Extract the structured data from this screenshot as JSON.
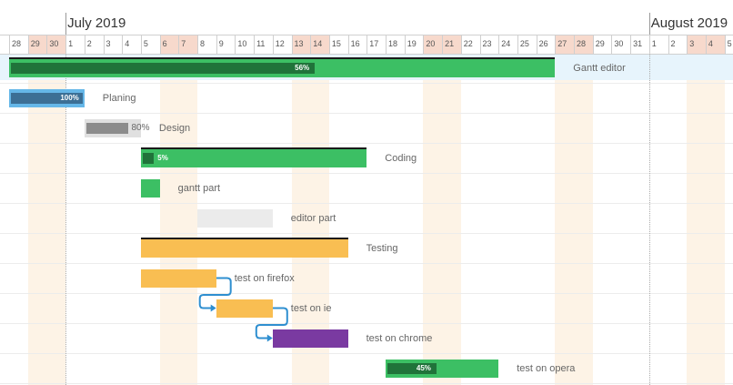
{
  "timeline": {
    "months": [
      {
        "label": "July 2019"
      },
      {
        "label": "August 2019"
      }
    ],
    "days": [
      {
        "label": "28",
        "weekend": false
      },
      {
        "label": "29",
        "weekend": true
      },
      {
        "label": "30",
        "weekend": true
      },
      {
        "label": "1",
        "weekend": false
      },
      {
        "label": "2",
        "weekend": false
      },
      {
        "label": "3",
        "weekend": false
      },
      {
        "label": "4",
        "weekend": false
      },
      {
        "label": "5",
        "weekend": false
      },
      {
        "label": "6",
        "weekend": true
      },
      {
        "label": "7",
        "weekend": true
      },
      {
        "label": "8",
        "weekend": false
      },
      {
        "label": "9",
        "weekend": false
      },
      {
        "label": "10",
        "weekend": false
      },
      {
        "label": "11",
        "weekend": false
      },
      {
        "label": "12",
        "weekend": false
      },
      {
        "label": "13",
        "weekend": true
      },
      {
        "label": "14",
        "weekend": true
      },
      {
        "label": "15",
        "weekend": false
      },
      {
        "label": "16",
        "weekend": false
      },
      {
        "label": "17",
        "weekend": false
      },
      {
        "label": "18",
        "weekend": false
      },
      {
        "label": "19",
        "weekend": false
      },
      {
        "label": "20",
        "weekend": true
      },
      {
        "label": "21",
        "weekend": true
      },
      {
        "label": "22",
        "weekend": false
      },
      {
        "label": "23",
        "weekend": false
      },
      {
        "label": "24",
        "weekend": false
      },
      {
        "label": "25",
        "weekend": false
      },
      {
        "label": "26",
        "weekend": false
      },
      {
        "label": "27",
        "weekend": true
      },
      {
        "label": "28",
        "weekend": true
      },
      {
        "label": "29",
        "weekend": false
      },
      {
        "label": "30",
        "weekend": false
      },
      {
        "label": "31",
        "weekend": false
      },
      {
        "label": "1",
        "weekend": false
      },
      {
        "label": "2",
        "weekend": false
      },
      {
        "label": "3",
        "weekend": true
      },
      {
        "label": "4",
        "weekend": true
      },
      {
        "label": "5",
        "weekend": false
      }
    ]
  },
  "tasks": [
    {
      "name": "Gantt editor",
      "start": 0,
      "duration": 29,
      "progress": 56,
      "progress_label": "56%",
      "color": "#3cbf64",
      "progress_color": "#20733a",
      "summary": true,
      "highlight": true
    },
    {
      "name": "Planing",
      "start": 0,
      "duration": 4,
      "progress": 100,
      "progress_label": "100%",
      "color": "#65b7e8",
      "progress_color": "#3c6f95",
      "summary": false
    },
    {
      "name": "Design",
      "start": 4,
      "duration": 3,
      "progress": 80,
      "progress_label": "80%",
      "color": "#e0e0e0",
      "progress_color": "#8c8c8c",
      "summary": false,
      "pct_outside": true
    },
    {
      "name": "Coding",
      "start": 7,
      "duration": 12,
      "progress": 5,
      "progress_label": "5%",
      "color": "#3cbf64",
      "progress_color": "#20733a",
      "summary": true
    },
    {
      "name": "gantt part",
      "start": 7,
      "duration": 1,
      "progress": 0,
      "progress_label": "",
      "color": "#3cbf64",
      "progress_color": "#20733a",
      "summary": false
    },
    {
      "name": "editor part",
      "start": 10,
      "duration": 4,
      "progress": 0,
      "progress_label": "",
      "color": "#ebebeb",
      "progress_color": "#8c8c8c",
      "summary": false
    },
    {
      "name": "Testing",
      "start": 7,
      "duration": 11,
      "progress": 0,
      "progress_label": "",
      "color": "#f9be52",
      "progress_color": "#f9be52",
      "summary": true
    },
    {
      "name": "test on firefox",
      "start": 7,
      "duration": 4,
      "progress": 0,
      "progress_label": "",
      "color": "#f9be52",
      "progress_color": "#f9be52",
      "summary": false
    },
    {
      "name": "test on ie",
      "start": 11,
      "duration": 3,
      "progress": 0,
      "progress_label": "",
      "color": "#f9be52",
      "progress_color": "#f9be52",
      "summary": false
    },
    {
      "name": "test on chrome",
      "start": 14,
      "duration": 4,
      "progress": 0,
      "progress_label": "",
      "color": "#7a3aa1",
      "progress_color": "#7a3aa1",
      "summary": false
    },
    {
      "name": "test on opera",
      "start": 20,
      "duration": 6,
      "progress": 45,
      "progress_label": "45%",
      "color": "#3cbf64",
      "progress_color": "#20733a",
      "summary": false
    }
  ],
  "links": [
    {
      "from": "test on firefox",
      "to": "test on ie"
    },
    {
      "from": "test on ie",
      "to": "test on chrome"
    }
  ],
  "colors": {
    "link": "#2f8fd0",
    "summary_row_bg": "#e7f4fc",
    "weekend_header": "#f7d9cc",
    "weekend_band": "#fdf3e6"
  }
}
